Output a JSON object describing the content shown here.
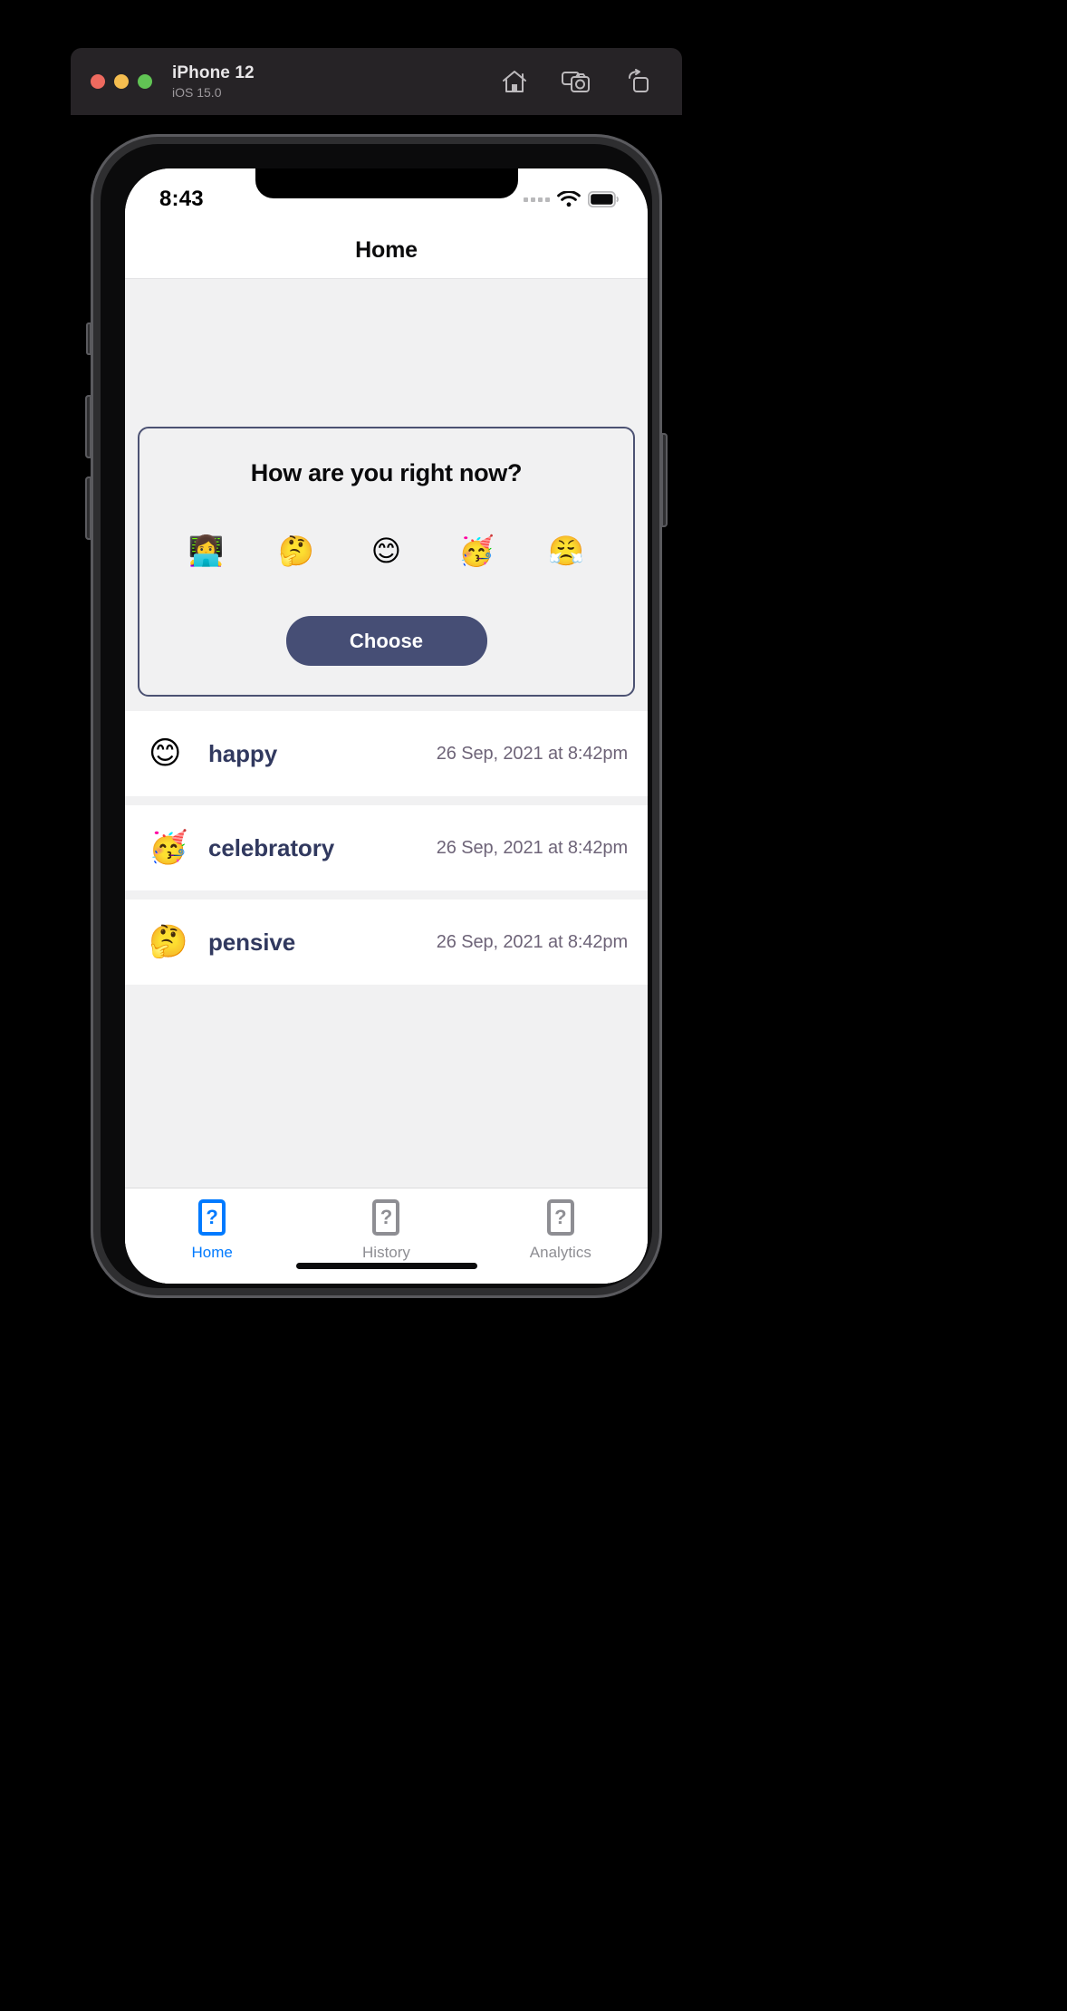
{
  "simulator": {
    "device_name": "iPhone 12",
    "os_version": "iOS 15.0",
    "traffic_lights": {
      "close": "close-red",
      "minimize": "minimize-yellow",
      "zoom": "zoom-green"
    },
    "toolbar": [
      {
        "name": "home-icon",
        "label": "Home"
      },
      {
        "name": "screenshot-camera-icon",
        "label": "Screenshot"
      },
      {
        "name": "rotate-icon",
        "label": "Rotate"
      }
    ]
  },
  "status_bar": {
    "time": "8:43",
    "signal": "signal-dots-icon",
    "wifi": "wifi-icon",
    "battery": "battery-icon"
  },
  "nav": {
    "title": "Home"
  },
  "mood_card": {
    "question": "How are you right now?",
    "emoji_options": [
      {
        "emoji": "👩‍💻",
        "name": "technologist-emoji"
      },
      {
        "emoji": "🤔",
        "name": "thinking-face-emoji"
      },
      {
        "emoji": "😊",
        "name": "smiling-face-emoji"
      },
      {
        "emoji": "🥳",
        "name": "partying-face-emoji"
      },
      {
        "emoji": "😤",
        "name": "triumph-face-emoji"
      }
    ],
    "choose_label": "Choose"
  },
  "mood_list": [
    {
      "emoji": "😊",
      "label": "happy",
      "date": "26 Sep, 2021 at 8:42pm"
    },
    {
      "emoji": "🥳",
      "label": "celebratory",
      "date": "26 Sep, 2021 at 8:42pm"
    },
    {
      "emoji": "🤔",
      "label": "pensive",
      "date": "26 Sep, 2021 at 8:42pm"
    }
  ],
  "tab_bar": {
    "active_index": 0,
    "items": [
      {
        "label": "Home",
        "icon": "question-mark-placeholder-icon",
        "glyph": "?"
      },
      {
        "label": "History",
        "icon": "question-mark-placeholder-icon",
        "glyph": "?"
      },
      {
        "label": "Analytics",
        "icon": "question-mark-placeholder-icon",
        "glyph": "?"
      }
    ]
  },
  "colors": {
    "accent_blue": "#007AFF",
    "card_border": "#4C5273",
    "button_bg": "#464E75",
    "label_navy": "#31395F",
    "date_gray": "#6E6478",
    "inactive_gray": "#8E8E93"
  }
}
